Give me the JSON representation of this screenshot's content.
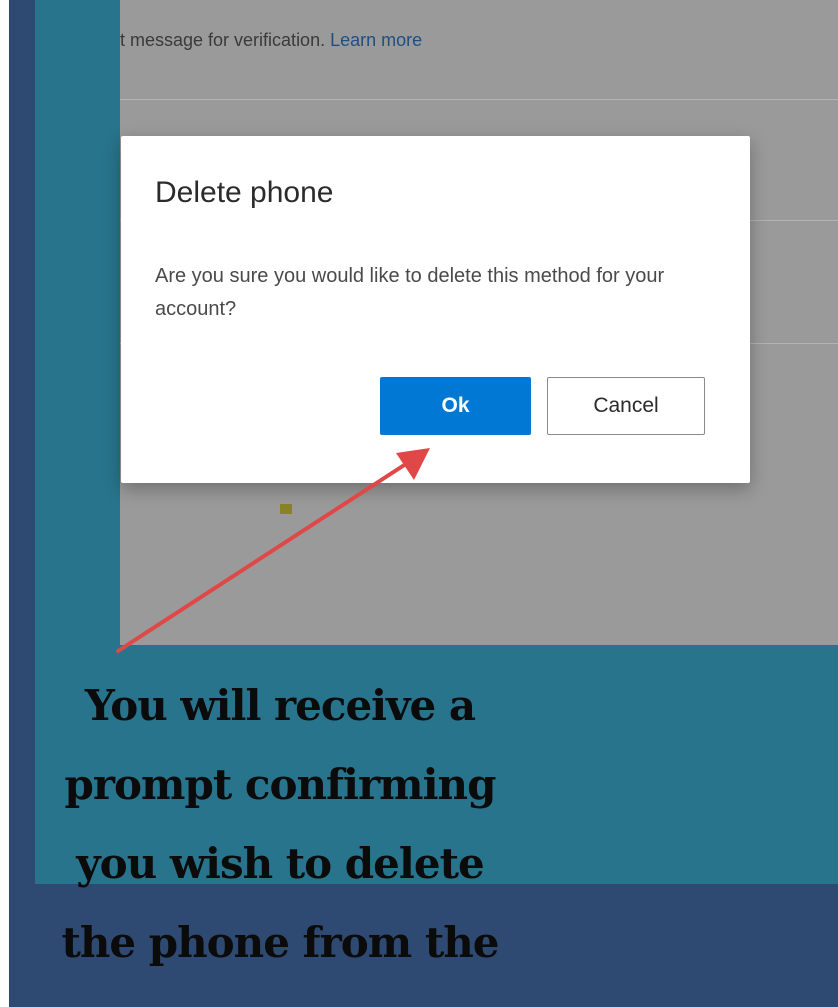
{
  "background": {
    "text": "t message for verification.",
    "link": "Learn more"
  },
  "dialog": {
    "title": "Delete phone",
    "body": "Are you sure you would like to delete this method for your account?",
    "ok_label": "Ok",
    "cancel_label": "Cancel"
  },
  "caption": {
    "lines": [
      "You will receive a",
      "prompt confirming",
      "you wish to delete",
      "the phone from the"
    ]
  },
  "colors": {
    "navy": "#2f4a72",
    "teal": "#28748c",
    "primary_button": "#0078d4",
    "arrow": "#e04848"
  },
  "icons": {
    "arrow": "red-arrow-icon"
  }
}
